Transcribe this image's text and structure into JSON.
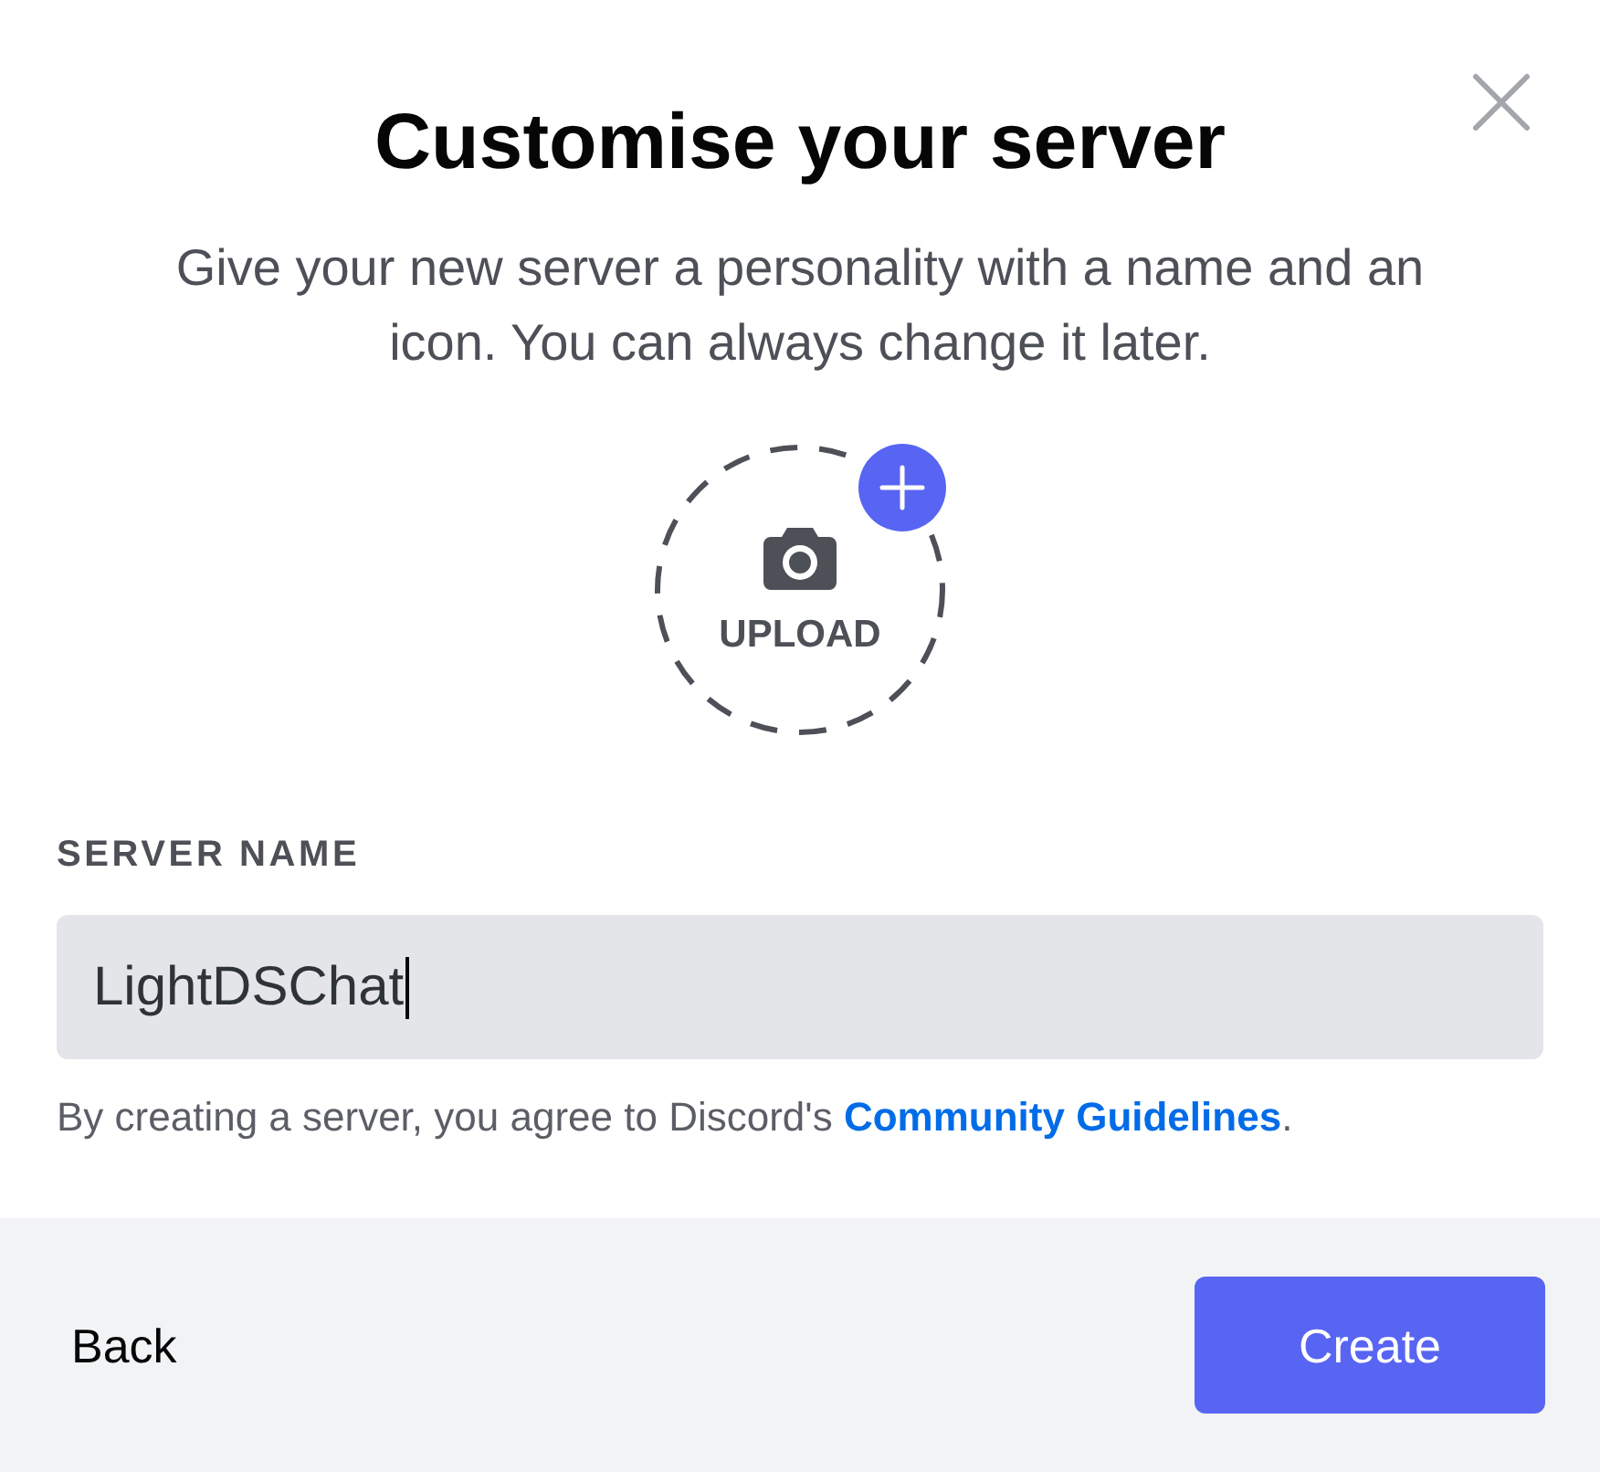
{
  "dialog": {
    "title": "Customise your server",
    "subtitle": "Give your new server a personality with a name and an icon. You can always change it later."
  },
  "upload": {
    "label": "UPLOAD"
  },
  "server_name": {
    "label": "SERVER NAME",
    "value": "LightDSChat",
    "focused": true
  },
  "terms": {
    "text": "By creating a server, you agree to Discord's",
    "link": "Community Guidelines",
    "end": "."
  },
  "footer": {
    "buttons": [
      {
        "label": "Back",
        "kind": "secondary"
      },
      {
        "label": "Create",
        "kind": "primary"
      }
    ]
  }
}
